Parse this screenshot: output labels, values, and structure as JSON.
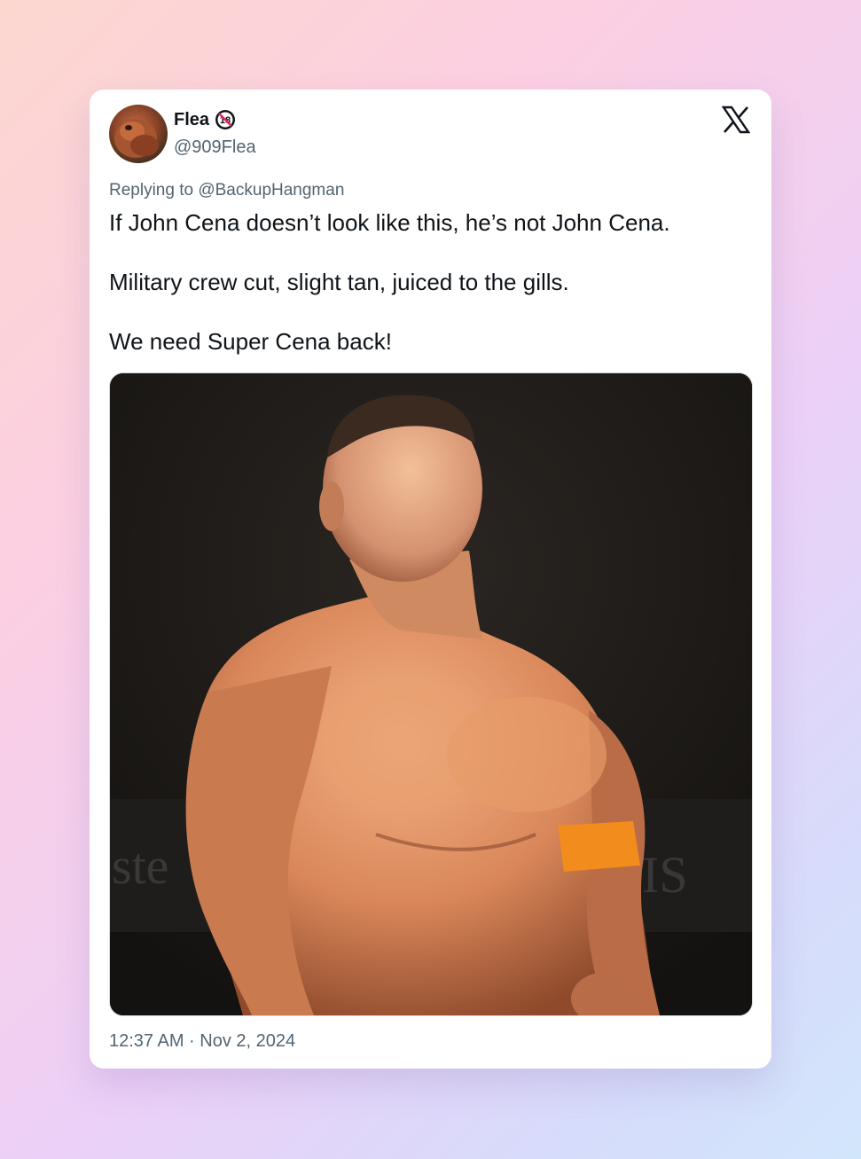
{
  "tweet": {
    "author_name": "Flea",
    "author_handle": "@909Flea",
    "badge_icon": "18-plus-badge-icon",
    "platform_icon": "x-logo-icon",
    "reply_prefix": "Replying to",
    "reply_mention": "@BackupHangman",
    "lines": [
      "If John Cena doesn’t look like this, he’s not John Cena.",
      "Military crew cut, slight tan, juiced to the gills.",
      "We need Super Cena back!"
    ],
    "timestamp": "12:37 AM · Nov 2, 2024",
    "media_background_text_left": "ste",
    "media_background_text_right": "IS"
  },
  "colors": {
    "text": "#0f1419",
    "secondary": "#536471",
    "armband": "#f28c1c",
    "badge_red": "#e0245e"
  }
}
